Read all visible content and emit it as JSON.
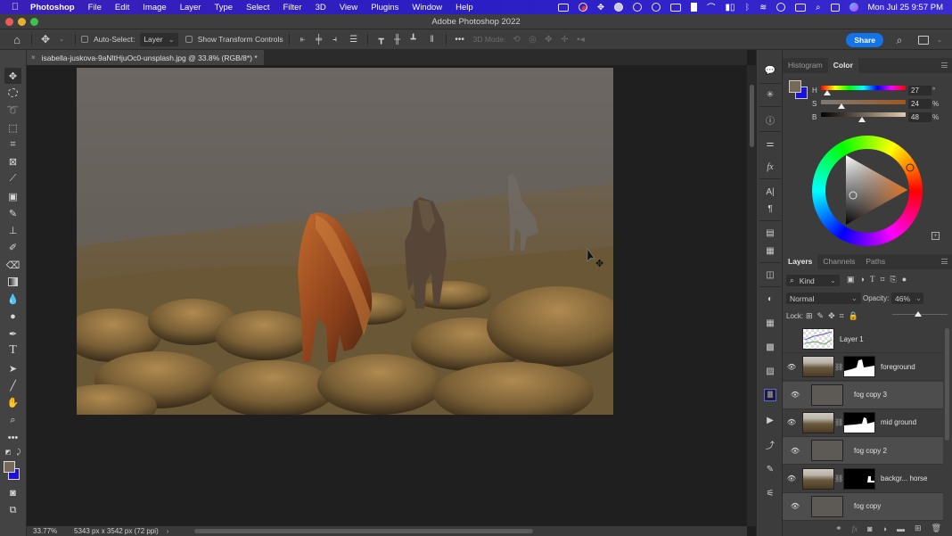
{
  "menubar": {
    "app_name": "Photoshop",
    "items": [
      "File",
      "Edit",
      "Image",
      "Layer",
      "Type",
      "Select",
      "Filter",
      "3D",
      "View",
      "Plugins",
      "Window",
      "Help"
    ],
    "status_icons": [
      "camera-icon",
      "record-icon",
      "dropbox-icon",
      "globe-icon",
      "screen-record-icon",
      "airplay-icon",
      "bookmark-icon",
      "gauge-icon",
      "grid-icon",
      "bluetooth-icon",
      "wifi-icon",
      "user-icon",
      "battery-icon",
      "search-icon",
      "control-center-icon",
      "siri-icon"
    ],
    "clock": "Mon Jul 25  9:57 PM"
  },
  "window": {
    "title": "Adobe Photoshop 2022"
  },
  "options_bar": {
    "auto_select_label": "Auto-Select:",
    "auto_select_checked": false,
    "auto_select_target": "Layer",
    "show_transform_label": "Show Transform Controls",
    "show_transform_checked": false,
    "three_d_mode_label": "3D Mode:",
    "share_label": "Share"
  },
  "document": {
    "tab_label": "isabella-juskova-9aNltHjuOc0-unsplash.jpg @ 33.8% (RGB/8*) *",
    "close_glyph": "×"
  },
  "status_bar": {
    "zoom": "33.77%",
    "doc_info": "5343 px x 3542 px (72 ppi)",
    "arrow": "›"
  },
  "color_panel": {
    "tabs": [
      {
        "label": "Histogram",
        "active": false
      },
      {
        "label": "Color",
        "active": true
      }
    ],
    "foreground_color": "#75695a",
    "background_color": "#1a10e0",
    "sliders": [
      {
        "label": "H",
        "value": "27",
        "unit": "°",
        "fraction": 0.075
      },
      {
        "label": "S",
        "value": "24",
        "unit": "%",
        "fraction": 0.24
      },
      {
        "label": "B",
        "value": "48",
        "unit": "%",
        "fraction": 0.48
      }
    ]
  },
  "layers_panel": {
    "tabs": [
      {
        "label": "Layers",
        "active": true
      },
      {
        "label": "Channels",
        "active": false
      },
      {
        "label": "Paths",
        "active": false
      }
    ],
    "filter_label": "Kind",
    "blend_mode": "Normal",
    "opacity_label": "Opacity:",
    "opacity_value": "46%",
    "opacity_fraction": 0.46,
    "lock_label": "Lock:",
    "layers": [
      {
        "name": "Layer 1",
        "visible": false,
        "type": "drawing",
        "mask": false,
        "selected": false
      },
      {
        "name": "foreground",
        "visible": true,
        "type": "photo",
        "mask": true,
        "selected": false
      },
      {
        "name": "fog copy 3",
        "visible": true,
        "type": "fog",
        "mask": false,
        "selected": true
      },
      {
        "name": "mid ground",
        "visible": true,
        "type": "photo",
        "mask": true,
        "selected": false
      },
      {
        "name": "fog copy 2",
        "visible": true,
        "type": "fog",
        "mask": false,
        "selected": true
      },
      {
        "name": "backgr... horse",
        "visible": true,
        "type": "photo",
        "mask": true,
        "selected": false
      },
      {
        "name": "fog copy",
        "visible": true,
        "type": "fog",
        "mask": false,
        "selected": true
      }
    ],
    "footer_icons": [
      "link-icon",
      "fx-icon",
      "mask-icon",
      "adjustment-icon",
      "folder-icon",
      "new-layer-icon",
      "trash-icon"
    ]
  }
}
